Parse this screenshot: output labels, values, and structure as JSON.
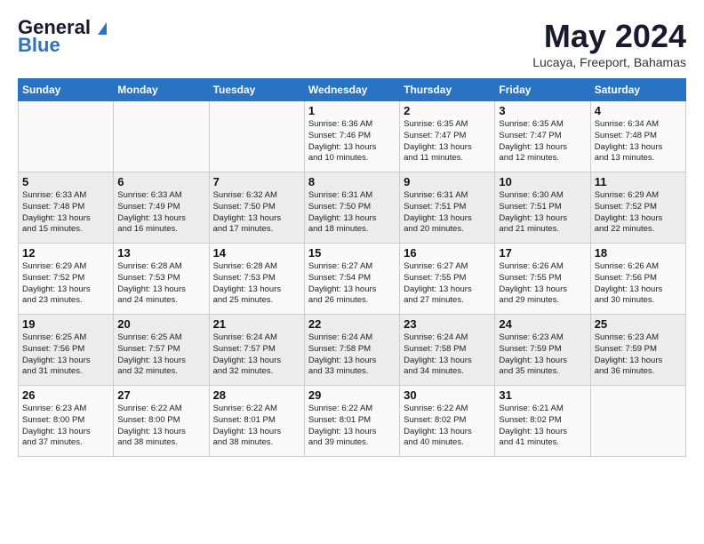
{
  "header": {
    "logo_line1": "General",
    "logo_line2": "Blue",
    "month": "May 2024",
    "location": "Lucaya, Freeport, Bahamas"
  },
  "days_of_week": [
    "Sunday",
    "Monday",
    "Tuesday",
    "Wednesday",
    "Thursday",
    "Friday",
    "Saturday"
  ],
  "weeks": [
    [
      {
        "num": "",
        "info": ""
      },
      {
        "num": "",
        "info": ""
      },
      {
        "num": "",
        "info": ""
      },
      {
        "num": "1",
        "info": "Sunrise: 6:36 AM\nSunset: 7:46 PM\nDaylight: 13 hours\nand 10 minutes."
      },
      {
        "num": "2",
        "info": "Sunrise: 6:35 AM\nSunset: 7:47 PM\nDaylight: 13 hours\nand 11 minutes."
      },
      {
        "num": "3",
        "info": "Sunrise: 6:35 AM\nSunset: 7:47 PM\nDaylight: 13 hours\nand 12 minutes."
      },
      {
        "num": "4",
        "info": "Sunrise: 6:34 AM\nSunset: 7:48 PM\nDaylight: 13 hours\nand 13 minutes."
      }
    ],
    [
      {
        "num": "5",
        "info": "Sunrise: 6:33 AM\nSunset: 7:48 PM\nDaylight: 13 hours\nand 15 minutes."
      },
      {
        "num": "6",
        "info": "Sunrise: 6:33 AM\nSunset: 7:49 PM\nDaylight: 13 hours\nand 16 minutes."
      },
      {
        "num": "7",
        "info": "Sunrise: 6:32 AM\nSunset: 7:50 PM\nDaylight: 13 hours\nand 17 minutes."
      },
      {
        "num": "8",
        "info": "Sunrise: 6:31 AM\nSunset: 7:50 PM\nDaylight: 13 hours\nand 18 minutes."
      },
      {
        "num": "9",
        "info": "Sunrise: 6:31 AM\nSunset: 7:51 PM\nDaylight: 13 hours\nand 20 minutes."
      },
      {
        "num": "10",
        "info": "Sunrise: 6:30 AM\nSunset: 7:51 PM\nDaylight: 13 hours\nand 21 minutes."
      },
      {
        "num": "11",
        "info": "Sunrise: 6:29 AM\nSunset: 7:52 PM\nDaylight: 13 hours\nand 22 minutes."
      }
    ],
    [
      {
        "num": "12",
        "info": "Sunrise: 6:29 AM\nSunset: 7:52 PM\nDaylight: 13 hours\nand 23 minutes."
      },
      {
        "num": "13",
        "info": "Sunrise: 6:28 AM\nSunset: 7:53 PM\nDaylight: 13 hours\nand 24 minutes."
      },
      {
        "num": "14",
        "info": "Sunrise: 6:28 AM\nSunset: 7:53 PM\nDaylight: 13 hours\nand 25 minutes."
      },
      {
        "num": "15",
        "info": "Sunrise: 6:27 AM\nSunset: 7:54 PM\nDaylight: 13 hours\nand 26 minutes."
      },
      {
        "num": "16",
        "info": "Sunrise: 6:27 AM\nSunset: 7:55 PM\nDaylight: 13 hours\nand 27 minutes."
      },
      {
        "num": "17",
        "info": "Sunrise: 6:26 AM\nSunset: 7:55 PM\nDaylight: 13 hours\nand 29 minutes."
      },
      {
        "num": "18",
        "info": "Sunrise: 6:26 AM\nSunset: 7:56 PM\nDaylight: 13 hours\nand 30 minutes."
      }
    ],
    [
      {
        "num": "19",
        "info": "Sunrise: 6:25 AM\nSunset: 7:56 PM\nDaylight: 13 hours\nand 31 minutes."
      },
      {
        "num": "20",
        "info": "Sunrise: 6:25 AM\nSunset: 7:57 PM\nDaylight: 13 hours\nand 32 minutes."
      },
      {
        "num": "21",
        "info": "Sunrise: 6:24 AM\nSunset: 7:57 PM\nDaylight: 13 hours\nand 32 minutes."
      },
      {
        "num": "22",
        "info": "Sunrise: 6:24 AM\nSunset: 7:58 PM\nDaylight: 13 hours\nand 33 minutes."
      },
      {
        "num": "23",
        "info": "Sunrise: 6:24 AM\nSunset: 7:58 PM\nDaylight: 13 hours\nand 34 minutes."
      },
      {
        "num": "24",
        "info": "Sunrise: 6:23 AM\nSunset: 7:59 PM\nDaylight: 13 hours\nand 35 minutes."
      },
      {
        "num": "25",
        "info": "Sunrise: 6:23 AM\nSunset: 7:59 PM\nDaylight: 13 hours\nand 36 minutes."
      }
    ],
    [
      {
        "num": "26",
        "info": "Sunrise: 6:23 AM\nSunset: 8:00 PM\nDaylight: 13 hours\nand 37 minutes."
      },
      {
        "num": "27",
        "info": "Sunrise: 6:22 AM\nSunset: 8:00 PM\nDaylight: 13 hours\nand 38 minutes."
      },
      {
        "num": "28",
        "info": "Sunrise: 6:22 AM\nSunset: 8:01 PM\nDaylight: 13 hours\nand 38 minutes."
      },
      {
        "num": "29",
        "info": "Sunrise: 6:22 AM\nSunset: 8:01 PM\nDaylight: 13 hours\nand 39 minutes."
      },
      {
        "num": "30",
        "info": "Sunrise: 6:22 AM\nSunset: 8:02 PM\nDaylight: 13 hours\nand 40 minutes."
      },
      {
        "num": "31",
        "info": "Sunrise: 6:21 AM\nSunset: 8:02 PM\nDaylight: 13 hours\nand 41 minutes."
      },
      {
        "num": "",
        "info": ""
      }
    ]
  ]
}
